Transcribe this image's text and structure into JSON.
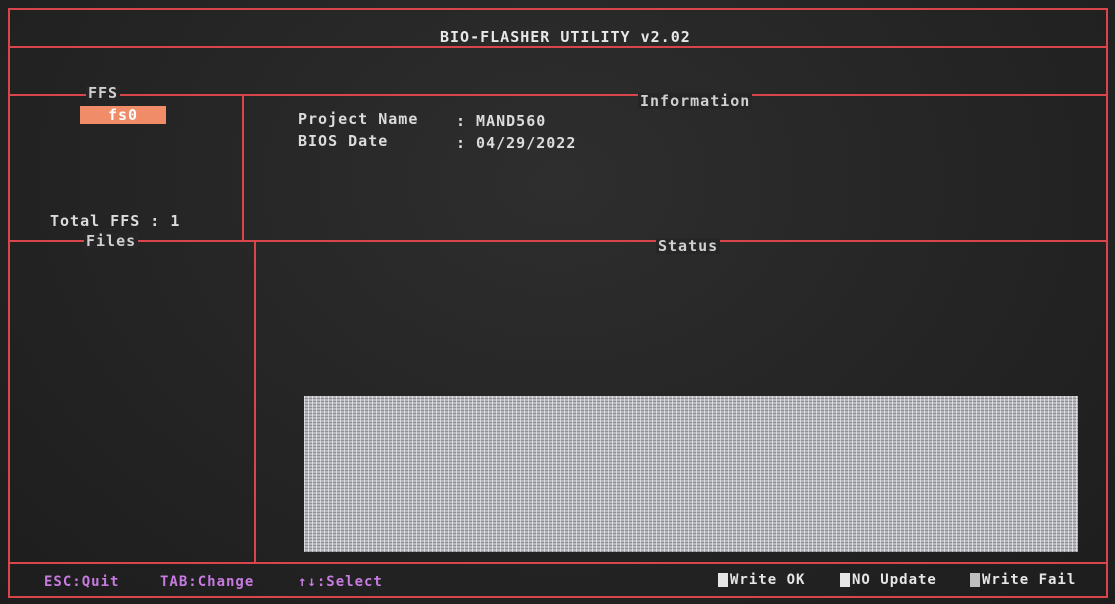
{
  "title": "BIO-FLASHER UTILITY v2.02",
  "ffs_panel": {
    "heading": "FFS",
    "items": [
      "fs0"
    ],
    "total_label": "Total FFS : 1"
  },
  "files_panel": {
    "heading": "Files"
  },
  "information_panel": {
    "heading": "Information",
    "project_name_label": "Project Name",
    "project_name_value": ": MAND560",
    "bios_date_label": "BIOS Date",
    "bios_date_value": ": 04/29/2022"
  },
  "status_panel": {
    "heading": "Status"
  },
  "footer": {
    "keys": [
      {
        "label": "ESC:Quit"
      },
      {
        "label": "TAB:Change"
      },
      {
        "label": "↑↓:Select"
      }
    ],
    "legend": [
      {
        "label": "Write OK",
        "color": "#e6e6e6"
      },
      {
        "label": "NO Update",
        "color": "#e6e6e6"
      },
      {
        "label": "Write Fail",
        "color": "#bfbfbf"
      }
    ]
  },
  "colors": {
    "border": "#d8454b",
    "selected_item": "#f08c68",
    "footer_keys": "#c77be0",
    "background": "#262626"
  }
}
